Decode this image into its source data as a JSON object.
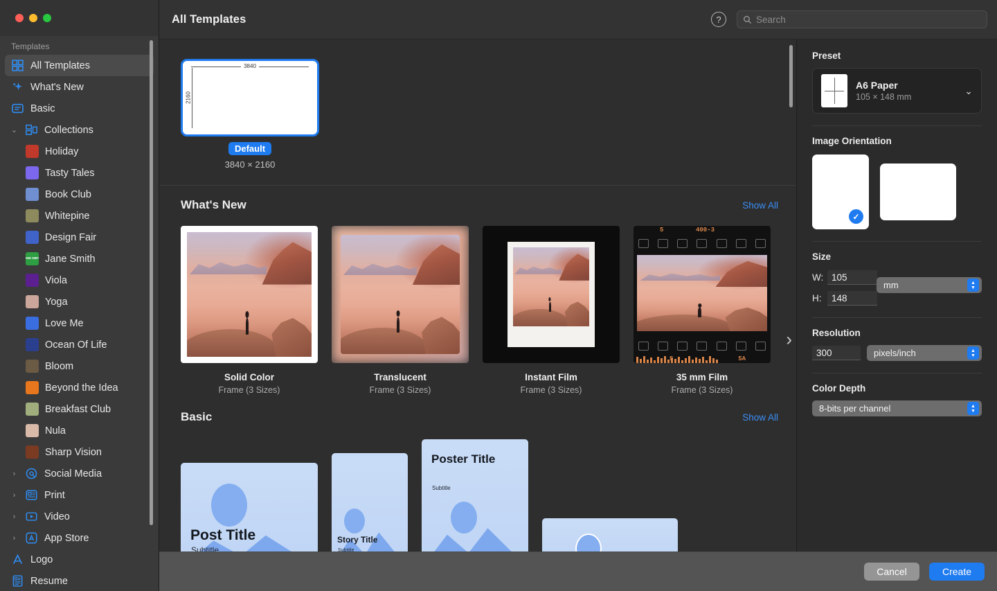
{
  "window": {
    "traffic_lights": [
      "close",
      "minimize",
      "zoom"
    ]
  },
  "topbar": {
    "title": "All Templates",
    "help_label": "?",
    "search_placeholder": "Search",
    "search_value": ""
  },
  "sidebar": {
    "header": "Templates",
    "items": [
      {
        "label": "All Templates",
        "icon": "grid-icon",
        "selected": true,
        "level": 0
      },
      {
        "label": "What's New",
        "icon": "sparkle-icon",
        "selected": false,
        "level": 0
      },
      {
        "label": "Basic",
        "icon": "basic-icon",
        "selected": false,
        "level": 0
      },
      {
        "label": "Collections",
        "icon": "collections-icon",
        "selected": false,
        "level": 0,
        "disclosure": "expanded"
      },
      {
        "label": "Holiday",
        "icon": "collection-thumb",
        "selected": false,
        "level": 1,
        "thumb": "#c0392b",
        "thumb_text": ""
      },
      {
        "label": "Tasty Tales",
        "icon": "collection-thumb",
        "selected": false,
        "level": 1,
        "thumb": "#7b68ee",
        "thumb_text": ""
      },
      {
        "label": "Book Club",
        "icon": "collection-thumb",
        "selected": false,
        "level": 1,
        "thumb": "#6f8fd0",
        "thumb_text": ""
      },
      {
        "label": "Whitepine",
        "icon": "collection-thumb",
        "selected": false,
        "level": 1,
        "thumb": "#8d8a5d",
        "thumb_text": ""
      },
      {
        "label": "Design Fair",
        "icon": "collection-thumb",
        "selected": false,
        "level": 1,
        "thumb": "#3f63c8",
        "thumb_text": ""
      },
      {
        "label": "Jane Smith",
        "icon": "collection-thumb",
        "selected": false,
        "level": 1,
        "thumb": "#2e9e43",
        "thumb_text": "JANE SMITH"
      },
      {
        "label": "Viola",
        "icon": "collection-thumb",
        "selected": false,
        "level": 1,
        "thumb": "#5b1f8f",
        "thumb_text": ""
      },
      {
        "label": "Yoga",
        "icon": "collection-thumb",
        "selected": false,
        "level": 1,
        "thumb": "#caa79a",
        "thumb_text": ""
      },
      {
        "label": "Love Me",
        "icon": "collection-thumb",
        "selected": false,
        "level": 1,
        "thumb": "#3a6de0",
        "thumb_text": ""
      },
      {
        "label": "Ocean Of Life",
        "icon": "collection-thumb",
        "selected": false,
        "level": 1,
        "thumb": "#2b3f8f",
        "thumb_text": ""
      },
      {
        "label": "Bloom",
        "icon": "collection-thumb",
        "selected": false,
        "level": 1,
        "thumb": "#6b5a44",
        "thumb_text": ""
      },
      {
        "label": "Beyond the Idea",
        "icon": "collection-thumb",
        "selected": false,
        "level": 1,
        "thumb": "#e8761c",
        "thumb_text": ""
      },
      {
        "label": "Breakfast Club",
        "icon": "collection-thumb",
        "selected": false,
        "level": 1,
        "thumb": "#9fae7c",
        "thumb_text": ""
      },
      {
        "label": "Nula",
        "icon": "collection-thumb",
        "selected": false,
        "level": 1,
        "thumb": "#d9b9a8",
        "thumb_text": ""
      },
      {
        "label": "Sharp Vision",
        "icon": "collection-thumb",
        "selected": false,
        "level": 1,
        "thumb": "#7a3b22",
        "thumb_text": ""
      },
      {
        "label": "Social Media",
        "icon": "at-icon",
        "selected": false,
        "level": 0,
        "disclosure": "collapsed"
      },
      {
        "label": "Print",
        "icon": "print-icon",
        "selected": false,
        "level": 0,
        "disclosure": "collapsed"
      },
      {
        "label": "Video",
        "icon": "video-icon",
        "selected": false,
        "level": 0,
        "disclosure": "collapsed"
      },
      {
        "label": "App Store",
        "icon": "appstore-icon",
        "selected": false,
        "level": 0,
        "disclosure": "collapsed"
      },
      {
        "label": "Logo",
        "icon": "logo-icon",
        "selected": false,
        "level": 0
      },
      {
        "label": "Resume",
        "icon": "resume-icon",
        "selected": false,
        "level": 0
      }
    ]
  },
  "gallery": {
    "default": {
      "badge": "Default",
      "size_label": "3840 × 2160",
      "width_mark": "3840",
      "height_mark": "2160"
    },
    "sections": [
      {
        "title": "What's New",
        "show_all": "Show All",
        "cards": [
          {
            "name": "Solid Color",
            "meta": "Frame (3 Sizes)",
            "style": "solid"
          },
          {
            "name": "Translucent",
            "meta": "Frame (3 Sizes)",
            "style": "translucent"
          },
          {
            "name": "Instant Film",
            "meta": "Frame (3 Sizes)",
            "style": "instant"
          },
          {
            "name": "35 mm Film",
            "meta": "Frame (3 Sizes)",
            "style": "film"
          }
        ]
      },
      {
        "title": "Basic",
        "show_all": "Show All",
        "cards": [
          {
            "name": "Post Title",
            "meta": "Subtitle",
            "style": "poster-post"
          },
          {
            "name": "Story Title",
            "meta": "Subtitle",
            "style": "poster-story"
          },
          {
            "name": "Poster Title",
            "meta": "Subtitle",
            "style": "poster-poster"
          },
          {
            "name": "",
            "meta": "",
            "style": "poster-wide"
          }
        ]
      }
    ],
    "film_marks": {
      "top_left": "5",
      "top_right": "400-3",
      "bottom_left": "5",
      "bottom_right": "5A"
    },
    "next_chevron": "›"
  },
  "inspector": {
    "preset": {
      "heading": "Preset",
      "name": "A6 Paper",
      "dimensions": "105 × 148 mm"
    },
    "orientation": {
      "heading": "Image Orientation",
      "portrait_selected": true,
      "check_glyph": "✓"
    },
    "size": {
      "heading": "Size",
      "w_label": "W:",
      "w_value": "105",
      "h_label": "H:",
      "h_value": "148",
      "unit": "mm"
    },
    "resolution": {
      "heading": "Resolution",
      "value": "300",
      "unit": "pixels/inch"
    },
    "color_depth": {
      "heading": "Color Depth",
      "value": "8-bits per channel"
    }
  },
  "footer": {
    "cancel": "Cancel",
    "create": "Create"
  },
  "colors": {
    "accent": "#1f7bf0",
    "link": "#3b8ef5",
    "sidebar_bg": "#3a3a3a",
    "main_bg": "#2e2e2e",
    "inspector_bg": "#2b2b2b",
    "footer_bg": "#545454"
  }
}
